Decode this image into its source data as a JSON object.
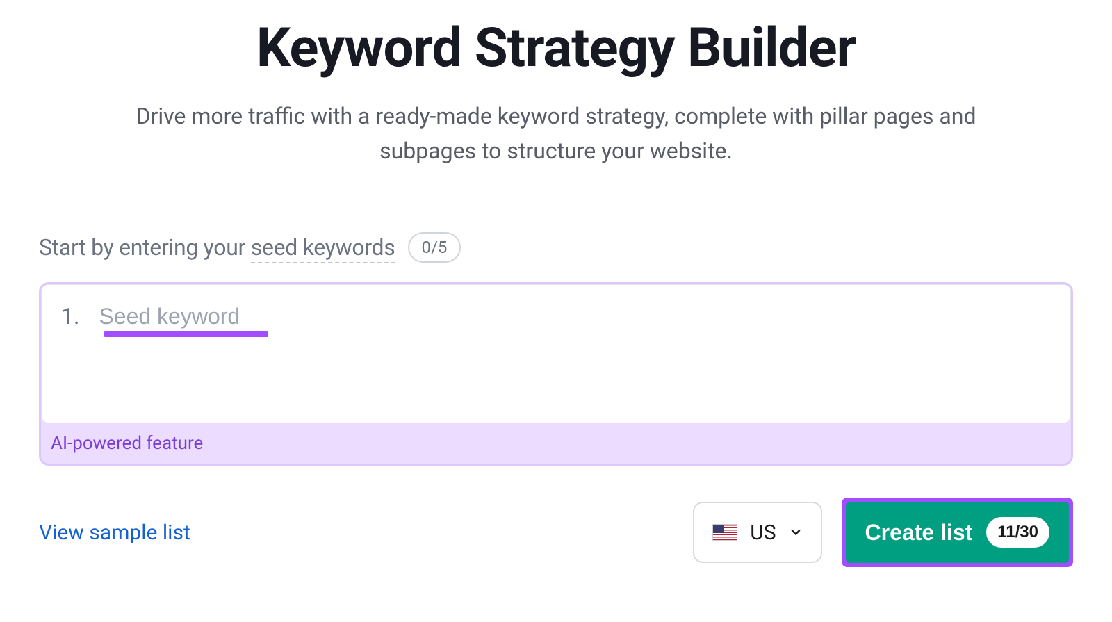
{
  "header": {
    "title": "Keyword Strategy Builder",
    "subtitle": "Drive more traffic with a ready-made keyword strategy, complete with pillar pages and subpages to structure your website."
  },
  "prompt": {
    "prefix": "Start by entering your ",
    "seed_term": "seed keywords",
    "count_label": "0/5"
  },
  "input": {
    "index_label": "1.",
    "placeholder": "Seed keyword",
    "value": "",
    "ai_footer": "AI-powered feature"
  },
  "actions": {
    "sample_link": "View sample list",
    "country": {
      "code": "US"
    },
    "create": {
      "label": "Create list",
      "quota": "11/30"
    }
  }
}
